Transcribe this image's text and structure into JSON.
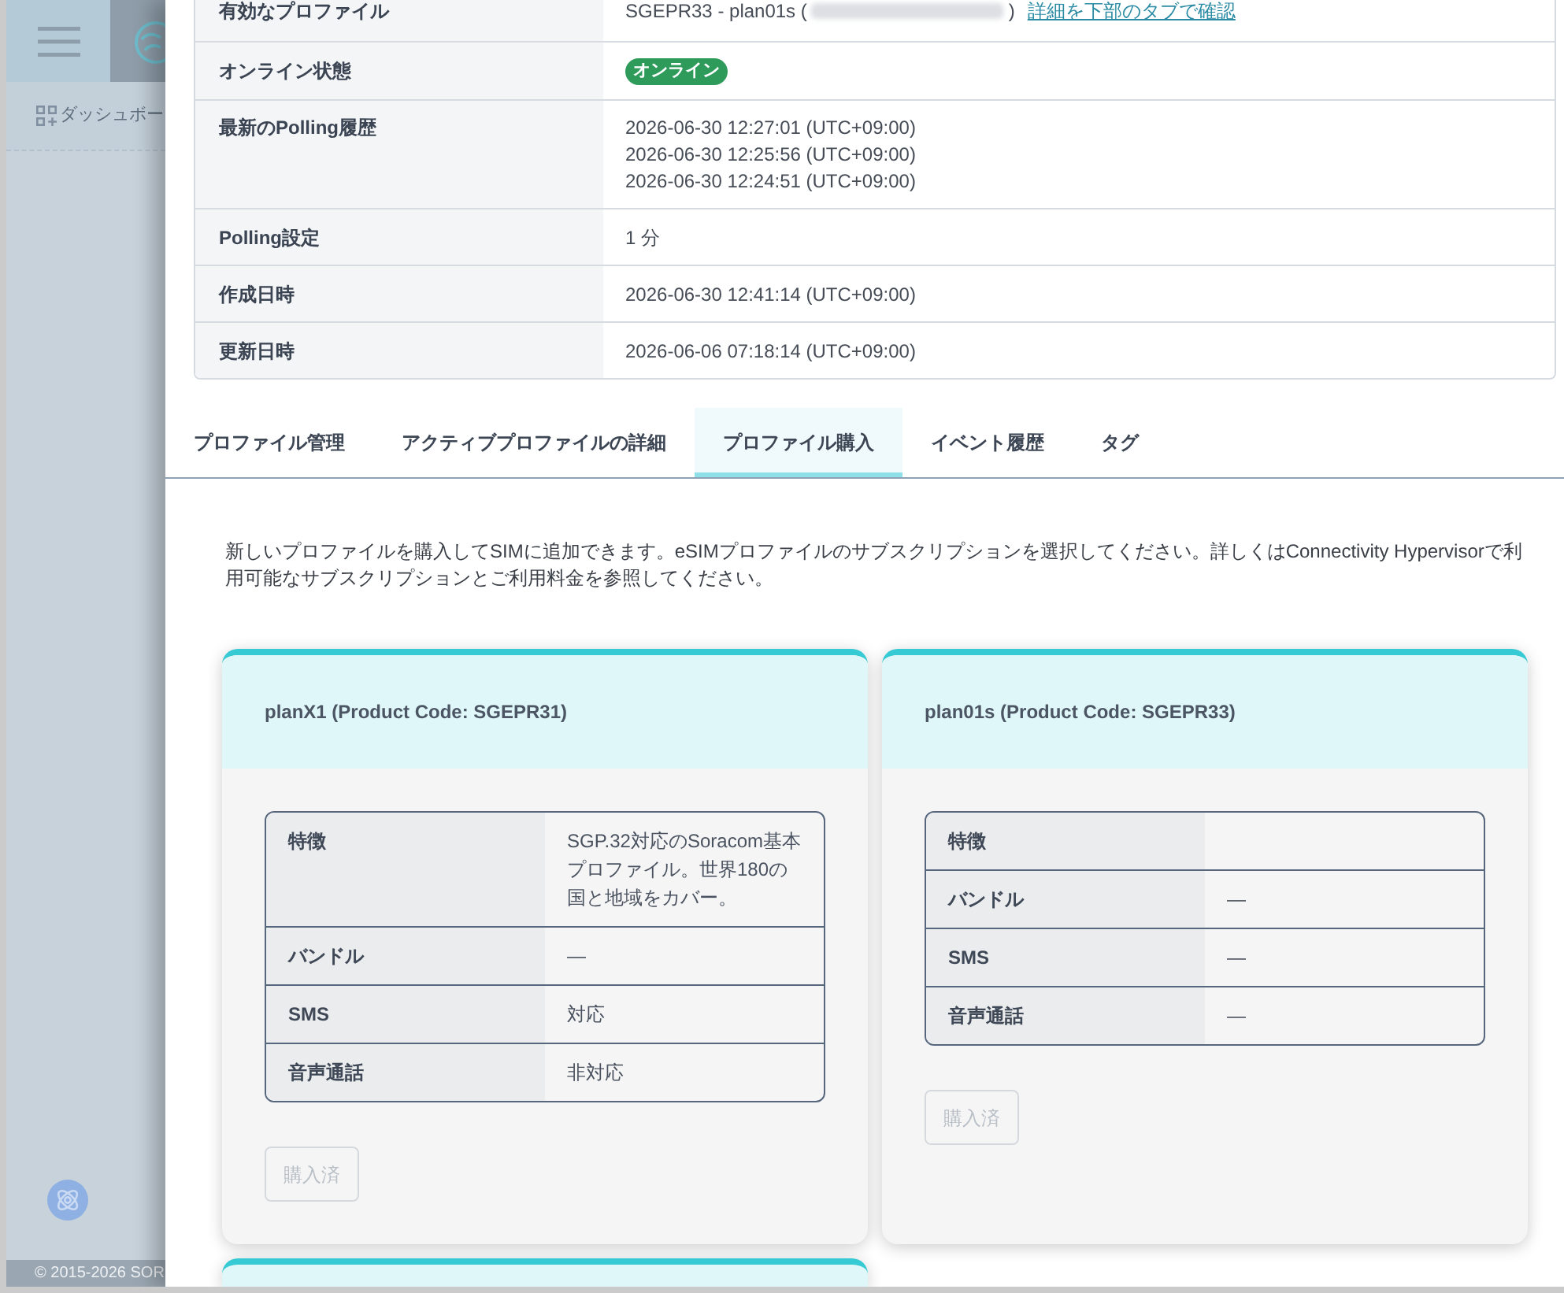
{
  "sidebar": {
    "nav_items": [
      {
        "label": "ダッシュボー"
      }
    ],
    "footer": "© 2015-2026 SOR"
  },
  "details": [
    {
      "kind": "profile",
      "label": "有効なプロファイル",
      "value": "SGEPR33 - plan01s (",
      "redacted": true,
      "value_end": ")",
      "link": "詳細を下部のタブで確認"
    },
    {
      "kind": "badge",
      "label": "オンライン状態",
      "badge": "オンライン"
    },
    {
      "kind": "lines",
      "label": "最新のPolling履歴",
      "lines": [
        "2026-06-30 12:27:01 (UTC+09:00)",
        "2026-06-30 12:25:56 (UTC+09:00)",
        "2026-06-30 12:24:51 (UTC+09:00)"
      ]
    },
    {
      "kind": "text",
      "label": "Polling設定",
      "value": "1 分"
    },
    {
      "kind": "text",
      "label": "作成日時",
      "value": "2026-06-30 12:41:14 (UTC+09:00)"
    },
    {
      "kind": "text",
      "label": "更新日時",
      "value": "2026-06-06 07:18:14 (UTC+09:00)"
    }
  ],
  "tabs": [
    {
      "label": "プロファイル管理",
      "selected": false
    },
    {
      "label": "アクティブプロファイルの詳細",
      "selected": false
    },
    {
      "label": "プロファイル購入",
      "selected": true
    },
    {
      "label": "イベント履歴",
      "selected": false
    },
    {
      "label": "タグ",
      "selected": false
    }
  ],
  "description": "新しいプロファイルを購入してSIMに追加できます。eSIMプロファイルのサブスクリプションを選択してください。詳しくはConnectivity Hypervisorで利用可能なサブスクリプションとご利用料金を参照してください。",
  "plans": [
    {
      "kind": "full",
      "title": "planX1 (Product Code: SGEPR31)",
      "features": [
        {
          "label": "特徴",
          "value": "SGP.32対応のSoracom基本プロファイル。世界180の国と地域をカバー。"
        },
        {
          "label": "バンドル",
          "value": "—"
        },
        {
          "label": "SMS",
          "value": "対応"
        },
        {
          "label": "音声通話",
          "value": "非対応"
        }
      ],
      "button": {
        "label": "購入済",
        "disabled": true
      }
    },
    {
      "kind": "full",
      "title": "plan01s (Product Code: SGEPR33)",
      "features": [
        {
          "label": "特徴"
        },
        {
          "label": "バンドル",
          "value": "—"
        },
        {
          "label": "SMS",
          "value": "—"
        },
        {
          "label": "音声通話",
          "value": "—"
        }
      ],
      "button": {
        "label": "購入済",
        "disabled": true
      }
    },
    {
      "kind": "cut_off"
    }
  ]
}
